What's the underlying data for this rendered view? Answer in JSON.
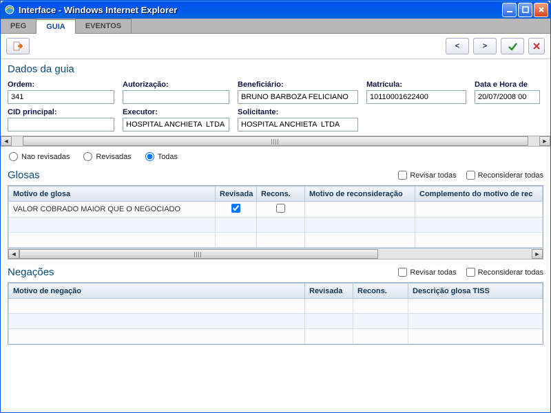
{
  "window": {
    "title": "Interface - Windows Internet Explorer"
  },
  "tabs": {
    "peg": "PEG",
    "guia": "GUIA",
    "eventos": "EVENTOS"
  },
  "toolbar": {
    "prev": "<",
    "next": ">"
  },
  "dados": {
    "title": "Dados da guia",
    "ordem_label": "Ordem:",
    "ordem": "341",
    "autorizacao_label": "Autorização:",
    "autorizacao": "",
    "beneficiario_label": "Beneficiário:",
    "beneficiario": "BRUNO BARBOZA FELICIANO",
    "matricula_label": "Matrícula:",
    "matricula": "10110001622400",
    "datahora_label": "Data e Hora de",
    "datahora": "20/07/2008 00",
    "cid_label": "CID principal:",
    "cid": "",
    "executor_label": "Executor:",
    "executor": "HOSPITAL ANCHIETA  LTDA",
    "solicitante_label": "Solicitante:",
    "solicitante": "HOSPITAL ANCHIETA  LTDA"
  },
  "filters": {
    "nao_revisadas": "Nao revisadas",
    "revisadas": "Revisadas",
    "todas": "Todas"
  },
  "glosas": {
    "title": "Glosas",
    "revisar_todas": "Revisar todas",
    "reconsiderar_todas": "Reconsiderar todas",
    "cols": {
      "motivo": "Motivo de glosa",
      "revisada": "Revisada",
      "recons": "Recons.",
      "motivo_recon": "Motivo de reconsideração",
      "complemento": "Complemento do motivo de rec"
    },
    "rows": [
      {
        "motivo": "VALOR COBRADO MAIOR QUE O NEGOCIADO",
        "revisada": true,
        "recons": false,
        "motivo_recon": "",
        "complemento": ""
      }
    ]
  },
  "negacoes": {
    "title": "Negações",
    "revisar_todas": "Revisar todas",
    "reconsiderar_todas": "Reconsiderar todas",
    "cols": {
      "motivo": "Motivo de negação",
      "revisada": "Revisada",
      "recons": "Recons.",
      "descricao": "Descrição glosa TISS"
    }
  }
}
